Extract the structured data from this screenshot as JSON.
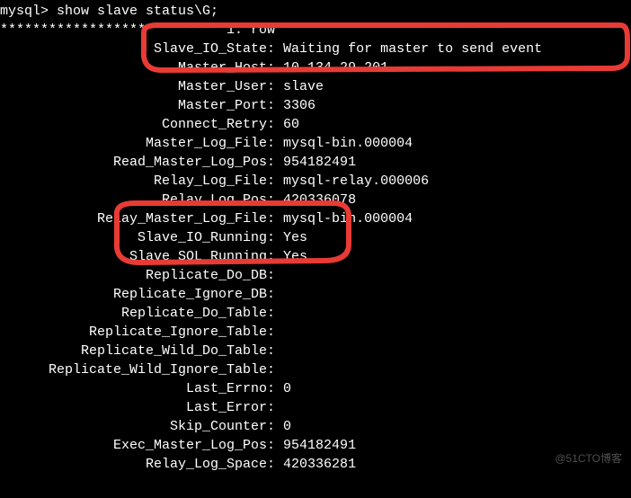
{
  "prompt": "mysql> show slave status\\G;",
  "row_header": "*************************** 1. row ***************************",
  "fields": [
    {
      "label": "Slave_IO_State",
      "value": "Waiting for master to send event"
    },
    {
      "label": "Master_Host",
      "value": "10.134.29.201"
    },
    {
      "label": "Master_User",
      "value": "slave"
    },
    {
      "label": "Master_Port",
      "value": "3306"
    },
    {
      "label": "Connect_Retry",
      "value": "60"
    },
    {
      "label": "Master_Log_File",
      "value": "mysql-bin.000004"
    },
    {
      "label": "Read_Master_Log_Pos",
      "value": "954182491"
    },
    {
      "label": "Relay_Log_File",
      "value": "mysql-relay.000006"
    },
    {
      "label": "Relay_Log_Pos",
      "value": "420336078"
    },
    {
      "label": "Relay_Master_Log_File",
      "value": "mysql-bin.000004"
    },
    {
      "label": "Slave_IO_Running",
      "value": "Yes"
    },
    {
      "label": "Slave_SQL_Running",
      "value": "Yes"
    },
    {
      "label": "Replicate_Do_DB",
      "value": ""
    },
    {
      "label": "Replicate_Ignore_DB",
      "value": ""
    },
    {
      "label": "Replicate_Do_Table",
      "value": ""
    },
    {
      "label": "Replicate_Ignore_Table",
      "value": ""
    },
    {
      "label": "Replicate_Wild_Do_Table",
      "value": ""
    },
    {
      "label": "Replicate_Wild_Ignore_Table",
      "value": ""
    },
    {
      "label": "Last_Errno",
      "value": "0"
    },
    {
      "label": "Last_Error",
      "value": ""
    },
    {
      "label": "Skip_Counter",
      "value": "0"
    },
    {
      "label": "Exec_Master_Log_Pos",
      "value": "954182491"
    },
    {
      "label": "Relay_Log_Space",
      "value": "420336281"
    }
  ],
  "label_width": 33,
  "watermark": "@51CTO博客",
  "annotations": {
    "highlight_color": "#e83b35"
  }
}
